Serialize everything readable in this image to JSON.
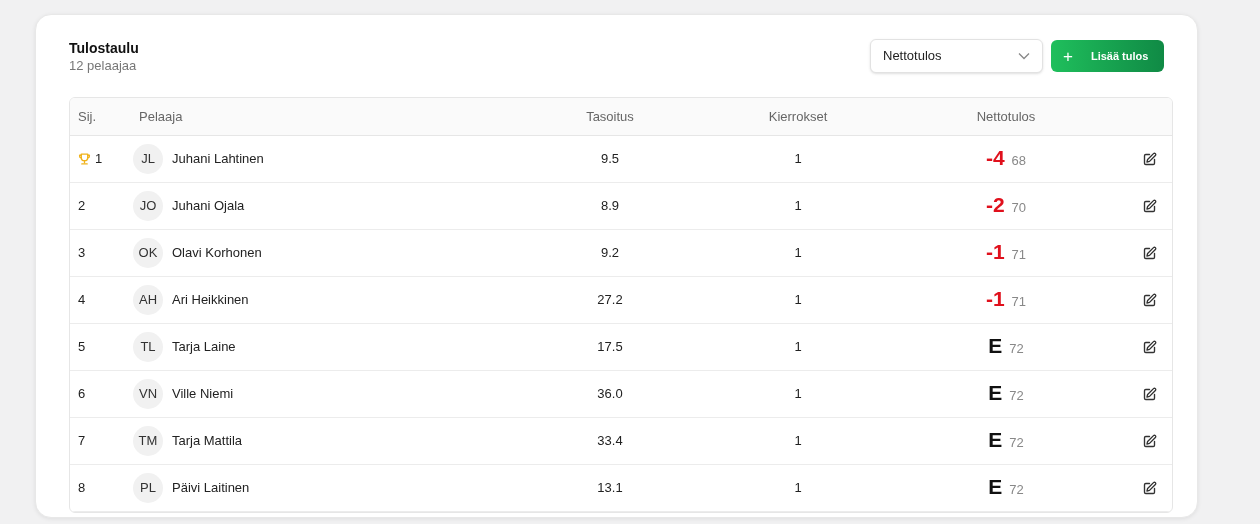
{
  "header": {
    "title": "Tulostaulu",
    "subtitle": "12 pelaajaa"
  },
  "sort_select": {
    "value": "Nettotulos"
  },
  "add_button": {
    "icon": "+",
    "label": "Lisää tulos"
  },
  "table": {
    "columns": [
      "Sij.",
      "Pelaaja",
      "Tasoitus",
      "Kierrokset",
      "Nettotulos"
    ],
    "rows": [
      {
        "rank": "1",
        "trophy": true,
        "initials": "JL",
        "name": "Juhani Lahtinen",
        "handicap": "9.5",
        "rounds": "1",
        "score": "-4",
        "color": "#e0101c",
        "strokes": "68"
      },
      {
        "rank": "2",
        "trophy": false,
        "initials": "JO",
        "name": "Juhani Ojala",
        "handicap": "8.9",
        "rounds": "1",
        "score": "-2",
        "color": "#e0101c",
        "strokes": "70"
      },
      {
        "rank": "3",
        "trophy": false,
        "initials": "OK",
        "name": "Olavi Korhonen",
        "handicap": "9.2",
        "rounds": "1",
        "score": "-1",
        "color": "#e0101c",
        "strokes": "71"
      },
      {
        "rank": "4",
        "trophy": false,
        "initials": "AH",
        "name": "Ari Heikkinen",
        "handicap": "27.2",
        "rounds": "1",
        "score": "-1",
        "color": "#e0101c",
        "strokes": "71"
      },
      {
        "rank": "5",
        "trophy": false,
        "initials": "TL",
        "name": "Tarja Laine",
        "handicap": "17.5",
        "rounds": "1",
        "score": "E",
        "color": "#111111",
        "strokes": "72"
      },
      {
        "rank": "6",
        "trophy": false,
        "initials": "VN",
        "name": "Ville Niemi",
        "handicap": "36.0",
        "rounds": "1",
        "score": "E",
        "color": "#111111",
        "strokes": "72"
      },
      {
        "rank": "7",
        "trophy": false,
        "initials": "TM",
        "name": "Tarja Mattila",
        "handicap": "33.4",
        "rounds": "1",
        "score": "E",
        "color": "#111111",
        "strokes": "72"
      },
      {
        "rank": "8",
        "trophy": false,
        "initials": "PL",
        "name": "Päivi Laitinen",
        "handicap": "13.1",
        "rounds": "1",
        "score": "E",
        "color": "#111111",
        "strokes": "72"
      }
    ]
  }
}
